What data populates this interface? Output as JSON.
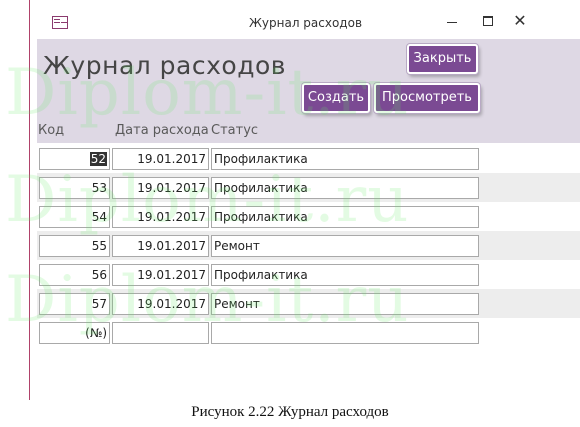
{
  "window": {
    "title": "Журнал расходов",
    "close_glyph": "✕"
  },
  "form": {
    "title": "Журнал расходов",
    "buttons": {
      "close": "Закрыть",
      "create": "Создать",
      "view": "Просмотреть"
    },
    "columns": {
      "code": "Код",
      "date": "Дата расхода",
      "status": "Статус"
    },
    "rows": [
      {
        "code": "52",
        "date": "19.01.2017",
        "status": "Профилактика",
        "selected": true
      },
      {
        "code": "53",
        "date": "19.01.2017",
        "status": "Профилактика"
      },
      {
        "code": "54",
        "date": "19.01.2017",
        "status": "Профилактика"
      },
      {
        "code": "55",
        "date": "19.01.2017",
        "status": "Ремонт"
      },
      {
        "code": "56",
        "date": "19.01.2017",
        "status": "Профилактика"
      },
      {
        "code": "57",
        "date": "19.01.2017",
        "status": "Ремонт"
      }
    ],
    "new_row": {
      "code": "(№)",
      "date": "",
      "status": ""
    }
  },
  "watermark": "Diplom-it.ru",
  "caption": "Рисунок 2.22 Журнал расходов",
  "colors": {
    "accent": "#7b4a93",
    "header_bg": "#ded8e4",
    "window_border": "#b0426a",
    "watermark": "#64eb64"
  }
}
